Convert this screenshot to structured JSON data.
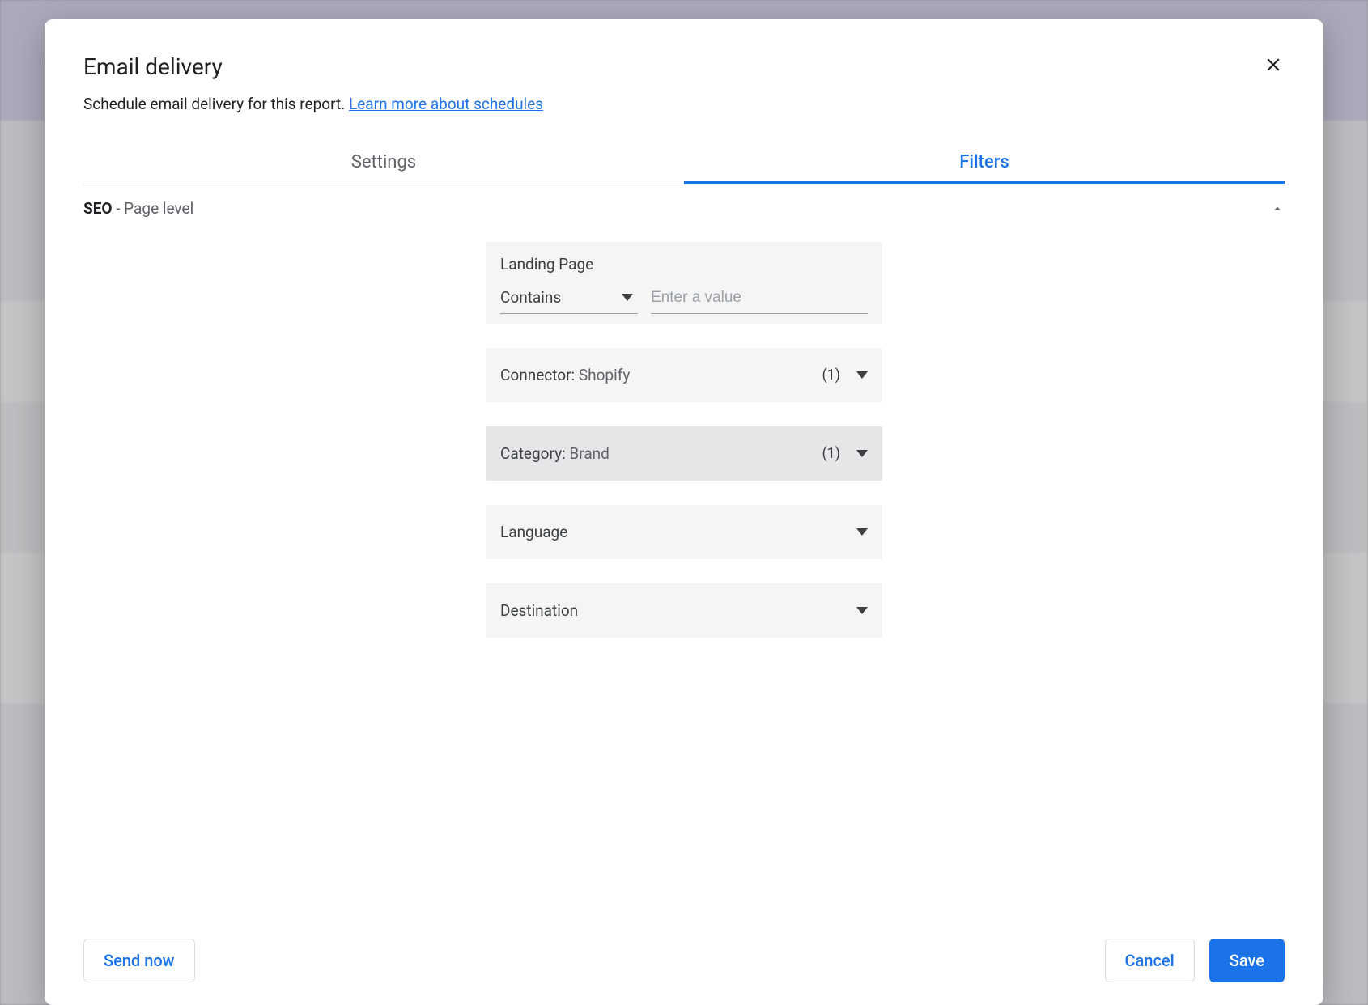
{
  "dialog": {
    "title": "Email delivery",
    "subtitle_prefix": "Schedule email delivery for this report. ",
    "learn_more": "Learn more about schedules"
  },
  "tabs": {
    "settings": "Settings",
    "filters": "Filters"
  },
  "section": {
    "name_bold": "SEO",
    "name_suffix": " - Page level"
  },
  "filters": {
    "landing_page": {
      "label": "Landing Page",
      "operator": "Contains",
      "placeholder": "Enter a value"
    },
    "connector": {
      "label": "Connector",
      "value": "Shopify",
      "count": "(1)"
    },
    "category": {
      "label": "Category",
      "value": "Brand",
      "count": "(1)"
    },
    "language": {
      "label": "Language"
    },
    "destination": {
      "label": "Destination"
    }
  },
  "footer": {
    "send_now": "Send now",
    "cancel": "Cancel",
    "save": "Save"
  }
}
